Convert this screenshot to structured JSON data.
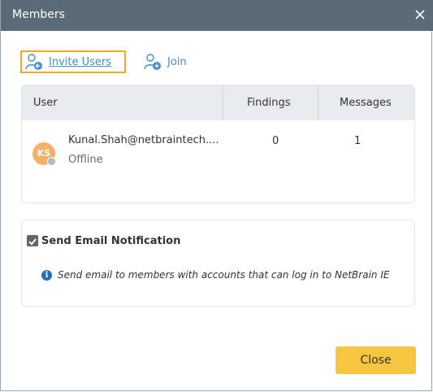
{
  "dialog": {
    "title": "Members",
    "titlebar_color": "#5a6a77"
  },
  "toolbar": {
    "invite_label": "Invite Users",
    "join_label": "Join",
    "link_color": "#3e8ed0",
    "focus_border_color": "#f5a623"
  },
  "table": {
    "headers": {
      "user": "User",
      "findings": "Findings",
      "messages": "Messages"
    },
    "rows": [
      {
        "initials": "KS",
        "name": "Kunal.Shah@netbraintech....",
        "status": "Offline",
        "findings": "0",
        "messages": "1",
        "avatar_color": "#f5b066"
      }
    ]
  },
  "notification": {
    "checkbox_label": "Send Email Notification",
    "checked": true,
    "info_text": "Send email to members with accounts that can log in to NetBrain IE"
  },
  "footer": {
    "close_label": "Close",
    "close_color": "#f7c640"
  },
  "icons": {
    "close": "close-icon",
    "invite": "invite-user-icon",
    "join": "join-user-icon",
    "info": "info-icon",
    "check": "checkmark-icon"
  }
}
